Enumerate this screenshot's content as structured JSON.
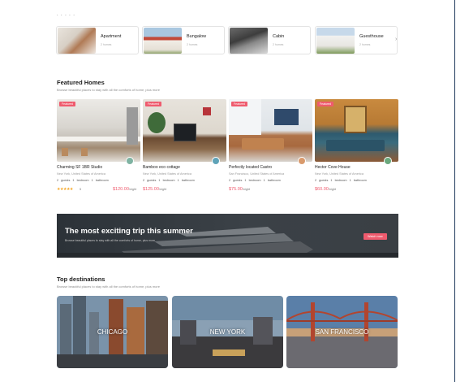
{
  "top_heading": "· · · · ·",
  "categories": [
    {
      "name": "Apartment",
      "count": "2 homes"
    },
    {
      "name": "Bungalow",
      "count": "2 homes"
    },
    {
      "name": "Cabin",
      "count": "2 homes"
    },
    {
      "name": "Guesthouse",
      "count": "2 homes"
    }
  ],
  "featured": {
    "title": "Featured Homes",
    "subtitle": "Browse beautiful places to stay with all the comforts of home, plus more",
    "listings": [
      {
        "badge": "Featured",
        "title": "Charming SF 1BR Studio",
        "location": "New York, United States of America",
        "meta": "2 guests  1 bedroom  1 bathroom",
        "stars": "★★★★★",
        "reviews": "5",
        "price": "$120.00",
        "per": "/night"
      },
      {
        "badge": "Featured",
        "title": "Bamboo eco cottage",
        "location": "New York, United States of America",
        "meta": "2 guests  1 bedroom  1 bathroom",
        "price": "$125.00",
        "per": "/night"
      },
      {
        "badge": "Featured",
        "title": "Perfectly located Castro",
        "location": "San Francisco, United States of America",
        "meta": "2 guests  1 bedroom  1 bathroom",
        "price": "$75.00",
        "per": "/night"
      },
      {
        "badge": "Featured",
        "title": "Hector Cove House",
        "location": "New York, United States of America",
        "meta": "2 guests  1 bedroom  1 bathroom",
        "price": "$60.00",
        "per": "/night"
      }
    ]
  },
  "banner": {
    "title": "The most exciting trip this summer",
    "subtitle": "Browse beautiful places to stay with all the comforts of home, plus more",
    "button": "Watch now"
  },
  "destinations": {
    "title": "Top destinations",
    "subtitle": "Browse beautiful places to stay with all the comforts of home, plus more",
    "items": [
      {
        "label": "CHICAGO"
      },
      {
        "label": "NEW YORK"
      },
      {
        "label": "SAN FRANCISCO"
      }
    ]
  },
  "colors": {
    "accent": "#ef5b6e",
    "star": "#f5a623",
    "banner": "#33393f"
  },
  "icons": {
    "next": "chevron-right-icon",
    "location": "map-pin-icon"
  }
}
